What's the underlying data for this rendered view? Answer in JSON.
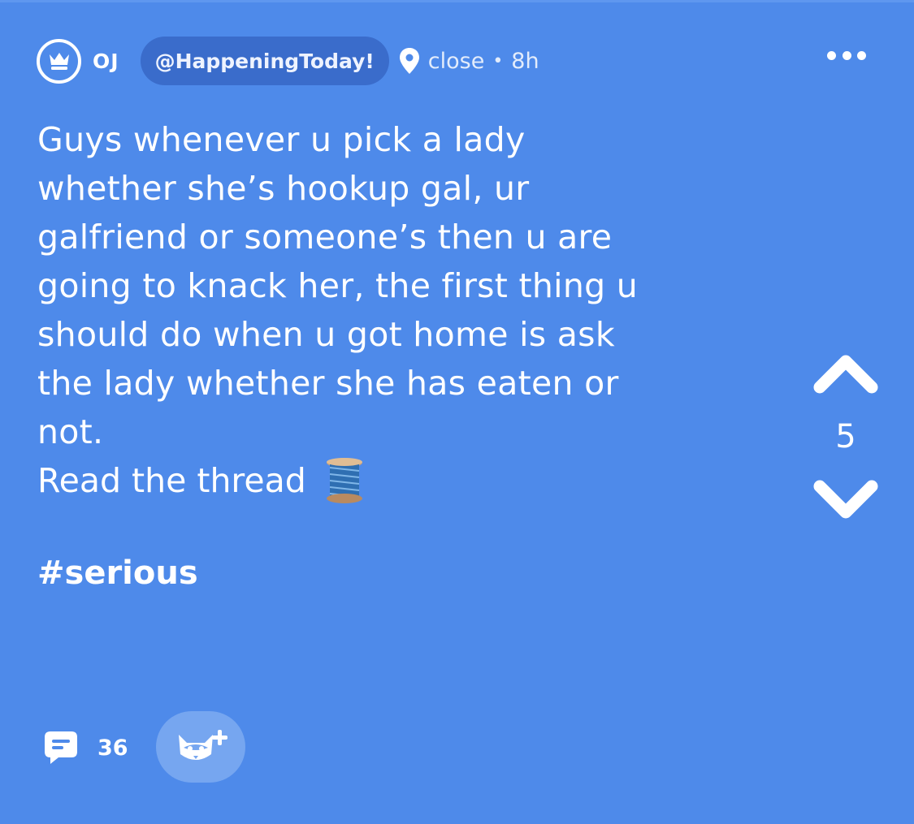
{
  "post": {
    "author": "OJ",
    "channel": "@HappeningToday!",
    "location": "close",
    "separator": "•",
    "time_ago": "8h",
    "body": "Guys whenever u pick a lady\nwhether she’s hookup gal, ur\ngalfriend or someone’s then u are\ngoing to knack her, the first thing u\nshould do when u got home is ask\nthe lady whether she has eaten or\nnot.",
    "thread_text": "Read the thread",
    "thread_emoji": "spool-of-thread",
    "hashtag": "#serious"
  },
  "votes": {
    "count": "5"
  },
  "footer": {
    "comment_count": "36"
  },
  "icons": {
    "author_badge": "crown-icon",
    "location": "map-pin-icon",
    "more": "ellipsis-icon",
    "upvote": "chevron-up-icon",
    "downvote": "chevron-down-icon",
    "comments": "comment-bubble-icon",
    "follow": "fox-plus-icon"
  },
  "colors": {
    "background": "#4e8aea",
    "channel_pill": "#3a6ccb",
    "follow_button": "#76a6f0",
    "text": "#ffffff"
  }
}
